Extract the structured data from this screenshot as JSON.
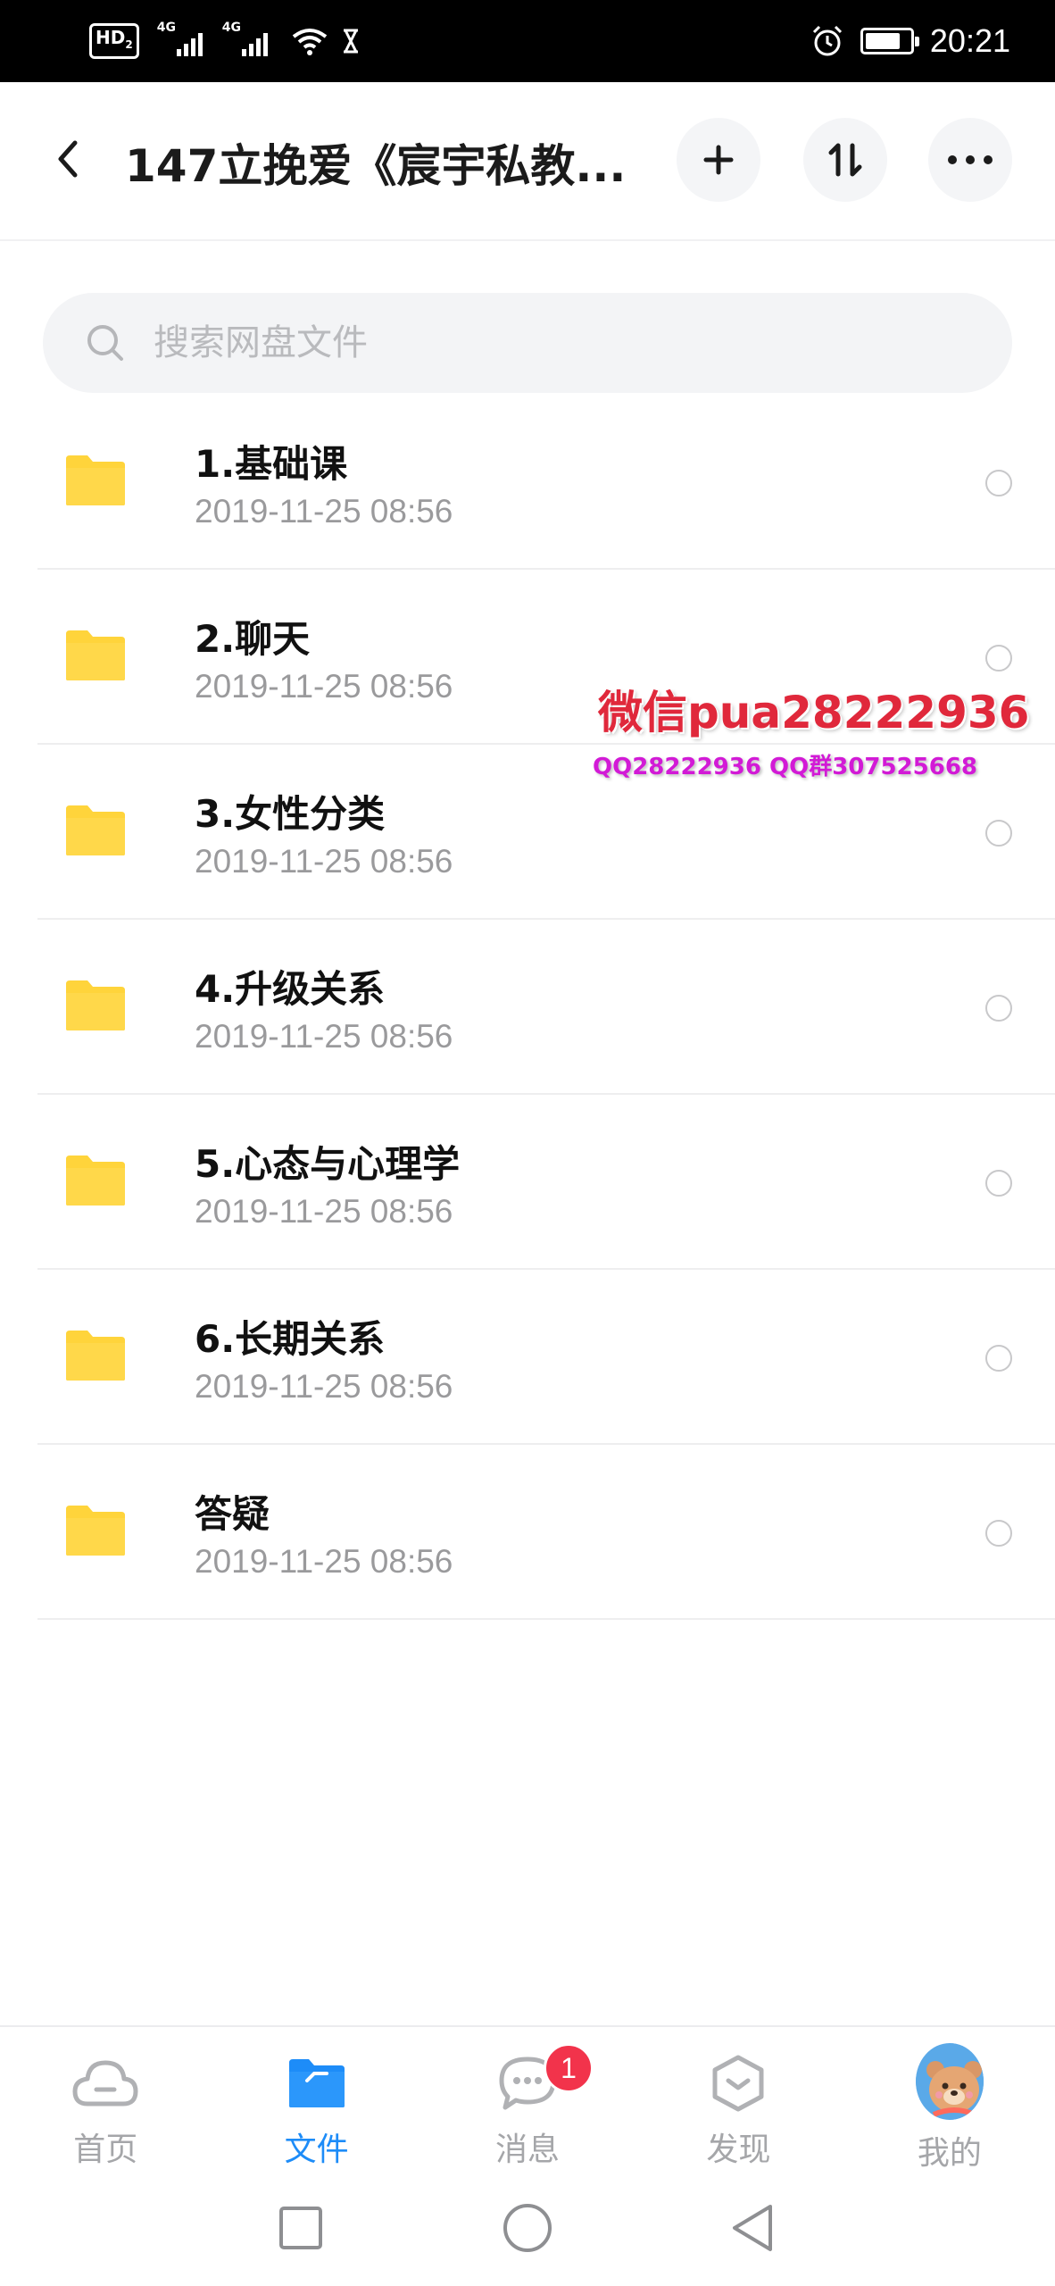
{
  "status_bar": {
    "hd": "HD",
    "hd_sub": "2",
    "net1": "4G",
    "net2": "4G",
    "time": "20:21",
    "battery_level": 0.8
  },
  "header": {
    "title": "147立挽爱《宸宇私教...",
    "back_icon": "chevron-left-icon",
    "add_icon": "plus-icon",
    "sort_icon": "sort-arrows-icon",
    "more_icon": "more-dots-icon"
  },
  "search": {
    "placeholder": "搜索网盘文件"
  },
  "files": [
    {
      "name": "1.基础课",
      "date": "2019-11-25  08:56"
    },
    {
      "name": "2.聊天",
      "date": "2019-11-25  08:56"
    },
    {
      "name": "3.女性分类",
      "date": "2019-11-25  08:56"
    },
    {
      "name": "4.升级关系",
      "date": "2019-11-25  08:56"
    },
    {
      "name": "5.心态与心理学",
      "date": "2019-11-25  08:56"
    },
    {
      "name": "6.长期关系",
      "date": "2019-11-25  08:56"
    },
    {
      "name": "答疑",
      "date": "2019-11-25  08:56"
    }
  ],
  "watermark": {
    "line1": "微信pua28222936",
    "line2": "QQ28222936  QQ群307525668"
  },
  "tabs": [
    {
      "label": "首页",
      "icon": "cloud-icon"
    },
    {
      "label": "文件",
      "icon": "folder-icon"
    },
    {
      "label": "消息",
      "icon": "chat-bubble-icon",
      "badge": "1"
    },
    {
      "label": "发现",
      "icon": "discover-icon"
    },
    {
      "label": "我的",
      "icon": "avatar-icon"
    }
  ],
  "colors": {
    "accent": "#1d8cf8",
    "folder": "#ffd43b",
    "badge": "#f2334b",
    "watermark_red": "#e0283b",
    "watermark_purple": "#d21ad6"
  }
}
